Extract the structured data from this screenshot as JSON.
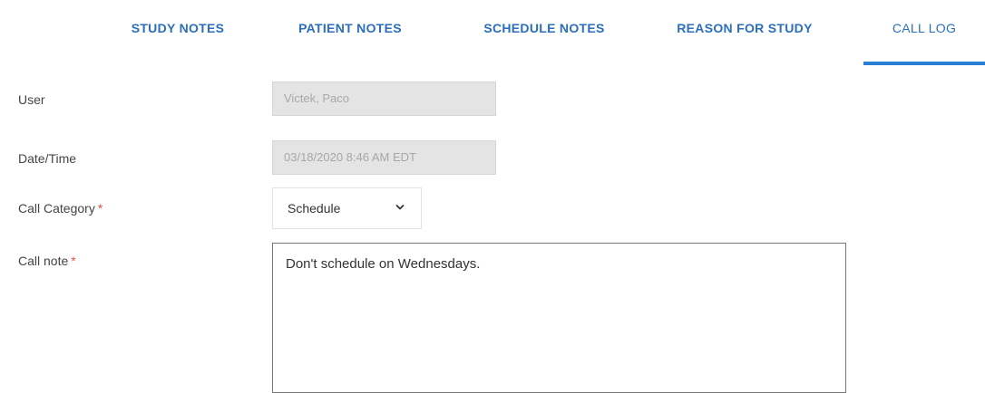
{
  "tabs": {
    "study_notes": "STUDY NOTES",
    "patient_notes": "PATIENT NOTES",
    "schedule_notes": "SCHEDULE NOTES",
    "reason_for_study": "REASON FOR STUDY",
    "call_log": "CALL LOG",
    "active": "call_log"
  },
  "form": {
    "user": {
      "label": "User",
      "value": "Victek, Paco"
    },
    "datetime": {
      "label": "Date/Time",
      "value": "03/18/2020 8:46 AM EDT"
    },
    "call_category": {
      "label": "Call Category",
      "required_mark": "*",
      "value": "Schedule"
    },
    "call_note": {
      "label": "Call note",
      "required_mark": "*",
      "value": "Don't schedule on Wednesdays."
    }
  },
  "colors": {
    "tab_text": "#2a6ebd",
    "active_underline": "#2a7fd4",
    "required": "#d9534f",
    "readonly_bg": "#e4e4e4"
  },
  "icons": {
    "select_arrow": "chevron-down-icon"
  }
}
